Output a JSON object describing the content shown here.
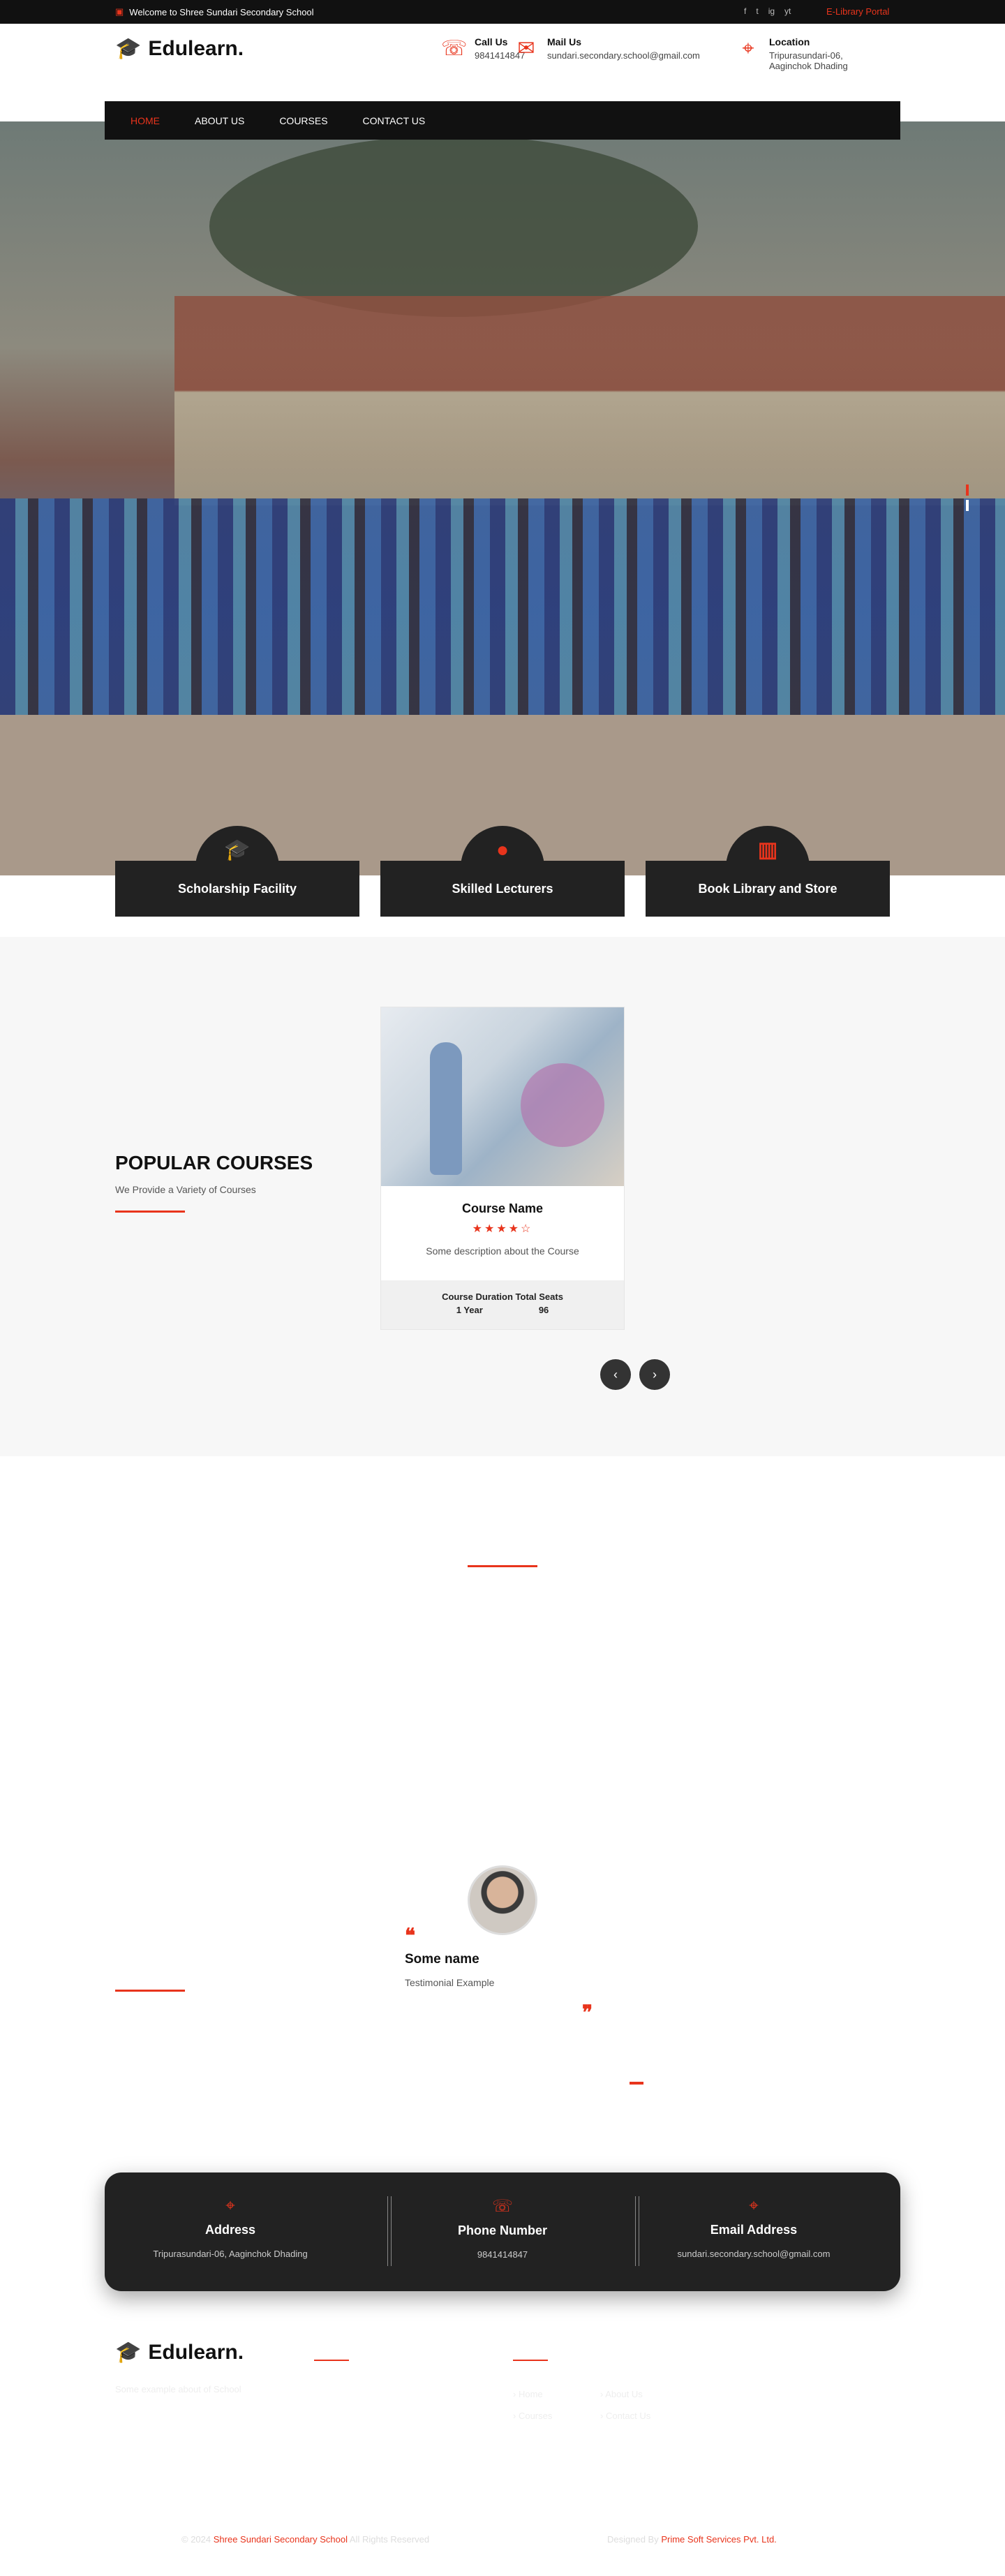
{
  "topbar": {
    "welcome": "Welcome to Shree Sundari Secondary School",
    "social": [
      "f",
      "t",
      "ig",
      "yt"
    ],
    "portal": "E-Library Portal"
  },
  "brand": {
    "name": "Edulearn.",
    "accent": "#e8341c"
  },
  "contacts": [
    {
      "title": "Call Us",
      "value": "9841414847",
      "icon": "phone-icon"
    },
    {
      "title": "Mail Us",
      "value": "sundari.secondary.school@gmail.com",
      "icon": "mail-icon"
    },
    {
      "title": "Location",
      "value": "Tripurasundari-06,",
      "value2": "Aaginchok Dhading",
      "icon": "location-icon"
    }
  ],
  "nav": [
    "HOME",
    "ABOUT US",
    "COURSES",
    "CONTACT US"
  ],
  "features": [
    {
      "label": "Scholarship Facility",
      "icon": "graduation-cap-icon"
    },
    {
      "label": "Skilled Lecturers",
      "icon": "user-icon"
    },
    {
      "label": "Book Library and Store",
      "icon": "book-icon"
    }
  ],
  "courses": {
    "title": "POPULAR COURSES",
    "subtitle": "We Provide a Variety of Courses",
    "card": {
      "name": "Course Name",
      "rating": "★★★★☆",
      "description": "Some description about the Course",
      "meta_header": "Course Duration Total Seats",
      "duration": "1 Year",
      "seats": "96"
    }
  },
  "testimonial": {
    "name": "Some name",
    "text": "Testimonial Example"
  },
  "info": [
    {
      "title": "Address",
      "value": "Tripurasundari-06, Aaginchok Dhading"
    },
    {
      "title": "Phone Number",
      "value": "9841414847"
    },
    {
      "title": "Email Address",
      "value": "sundari.secondary.school@gmail.com"
    }
  ],
  "footer": {
    "about": "Some example about of School",
    "links": [
      "Home",
      "About Us",
      "Courses",
      "Contact Us"
    ],
    "copyright_prefix": "© 2024",
    "copyright_name": "Shree Sundari Secondary School",
    "copyright_suffix": "All Rights Reserved",
    "designed_prefix": "Designed By",
    "designed_by": "Prime Soft Services Pvt. Ltd."
  }
}
